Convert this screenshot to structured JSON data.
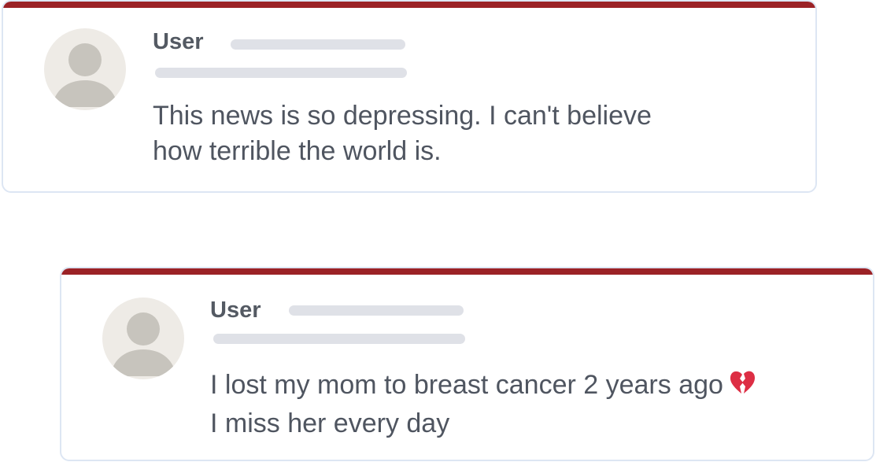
{
  "colors": {
    "accent_bar": "#9b2226",
    "card_border": "#dde6f3",
    "avatar_bg": "#eeebe6",
    "avatar_figure": "#c7c4bd",
    "skeleton": "#dfe1e7",
    "text": "#4f5560"
  },
  "comments": [
    {
      "username": "User",
      "avatar_icon": "default-user-icon",
      "lines": [
        "This news is so depressing. I can't believe",
        "how terrible the world is."
      ]
    },
    {
      "username": "User",
      "avatar_icon": "default-user-icon",
      "lines": [
        "I lost my mom to breast cancer 2 years ago",
        "I miss her every day"
      ],
      "emoji": "broken-heart-icon"
    }
  ]
}
